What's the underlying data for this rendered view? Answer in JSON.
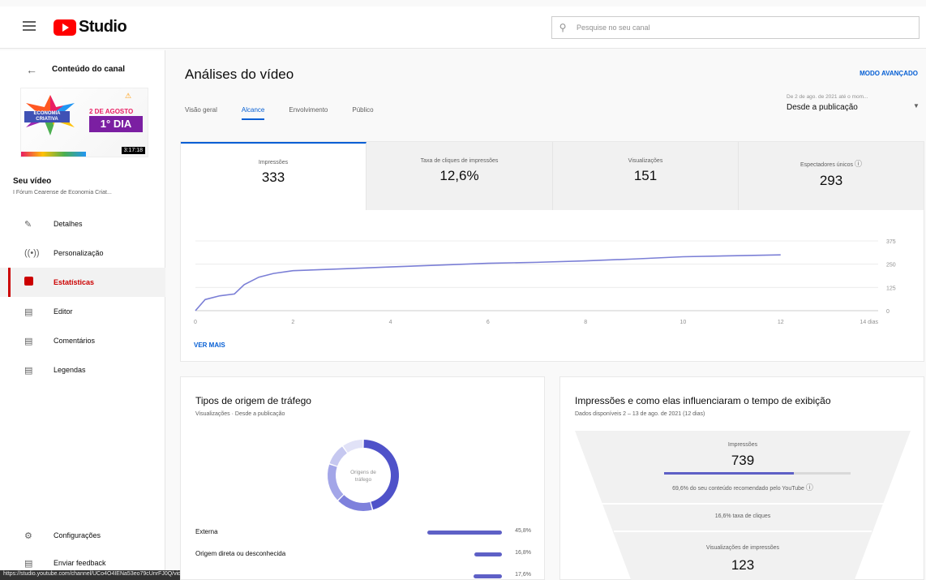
{
  "app": {
    "name": "Studio"
  },
  "search": {
    "placeholder": "Pesquise no seu canal"
  },
  "sidebar": {
    "header": "Conteúdo do canal",
    "thumbnail": {
      "date": "2 DE AGOSTO",
      "day": "1° DIA",
      "band": "ECONOMIA CRIATIVA",
      "duration": "3:17:18"
    },
    "video_title": "Seu vídeo",
    "video_subtitle": "I Fórum Cearense de Economia Criat...",
    "items": [
      {
        "label": "Detalhes",
        "icon": "pencil-icon"
      },
      {
        "label": "Personalização",
        "icon": "broadcast-icon"
      },
      {
        "label": "Estatísticas",
        "icon": "analytics-icon",
        "active": true
      },
      {
        "label": "Editor",
        "icon": "film-icon"
      },
      {
        "label": "Comentários",
        "icon": "comment-icon"
      },
      {
        "label": "Legendas",
        "icon": "subtitles-icon"
      }
    ],
    "bottom": [
      {
        "label": "Configurações",
        "icon": "gear-icon"
      },
      {
        "label": "Enviar feedback",
        "icon": "feedback-icon"
      }
    ]
  },
  "status_url": "https://studio.youtube.com/channel/UCo4O4IENa53eo79cUnrFJ0Q/videos",
  "main": {
    "title": "Análises do vídeo",
    "advanced": "MODO AVANÇADO",
    "tabs": [
      "Visão geral",
      "Alcance",
      "Envolvimento",
      "Público"
    ],
    "active_tab": 1,
    "date_small": "De 2 de ago. de 2021 até o mom...",
    "date_value": "Desde a publicação",
    "metrics": [
      {
        "label": "Impressões",
        "value": "333"
      },
      {
        "label": "Taxa de cliques de impressões",
        "value": "12,6%"
      },
      {
        "label": "Visualizações",
        "value": "151"
      },
      {
        "label": "Espectadores únicos",
        "value": "293"
      }
    ],
    "ver_mais": "VER MAIS"
  },
  "chart_data": {
    "type": "line",
    "x": [
      0,
      0.2,
      0.5,
      0.8,
      1.0,
      1.3,
      1.6,
      2.0,
      3,
      4,
      5,
      6,
      7,
      8,
      9,
      10,
      11,
      12
    ],
    "y": [
      0,
      60,
      80,
      90,
      140,
      180,
      200,
      215,
      225,
      235,
      245,
      255,
      260,
      268,
      278,
      290,
      295,
      300
    ],
    "x_ticks": [
      "0",
      "2",
      "4",
      "6",
      "8",
      "10",
      "12",
      "14 dias"
    ],
    "x_tick_values": [
      0,
      2,
      4,
      6,
      8,
      10,
      12,
      14
    ],
    "y_ticks": [
      "0",
      "125",
      "250",
      "375"
    ],
    "y_tick_values": [
      0,
      125,
      250,
      375
    ],
    "xlim": [
      0,
      14
    ],
    "ylim": [
      0,
      375
    ],
    "color": "#7b7fd6"
  },
  "traffic": {
    "title": "Tipos de origem de tráfego",
    "subtitle": "Visualizações · Desde a publicação",
    "donut_label_1": "Origens de",
    "donut_label_2": "tráfego",
    "rows": [
      {
        "name": "Externa",
        "pct": "45,8%",
        "value": 45.8
      },
      {
        "name": "Origem direta ou desconhecida",
        "pct": "16,8%",
        "value": 16.8
      },
      {
        "name": "",
        "pct": "17,6%",
        "value": 17.6
      }
    ],
    "donut_segments": [
      {
        "value": 45.8,
        "color": "#4f52c9"
      },
      {
        "value": 16.8,
        "color": "#7e81dc"
      },
      {
        "value": 17.6,
        "color": "#a3a6e8"
      },
      {
        "value": 10.0,
        "color": "#c6c8f0"
      },
      {
        "value": 9.8,
        "color": "#e1e2f7"
      }
    ]
  },
  "impressions": {
    "title": "Impressões e como elas influenciaram o tempo de exibição",
    "subtitle": "Dados disponíveis 2 – 13 de ago. de 2021 (12 dias)",
    "impr_label": "Impressões",
    "impr_value": "739",
    "recommended_fraction": 0.696,
    "recommended_text": "69,6% do seu conteúdo recomendado pelo YouTube",
    "ctr_text": "16,6% taxa de cliques",
    "views_label": "Visualizações de impressões",
    "views_value": "123"
  }
}
